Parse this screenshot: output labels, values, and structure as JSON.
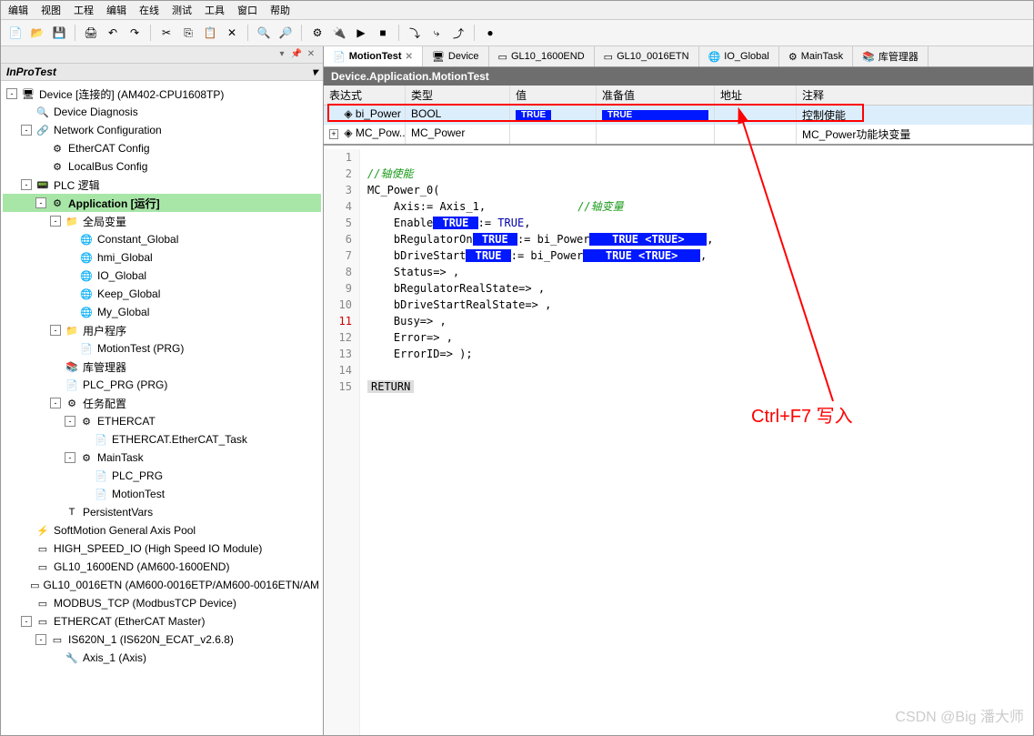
{
  "menu": [
    "编辑",
    "视图",
    "工程",
    "编辑",
    "在线",
    "测试",
    "工具",
    "窗口",
    "帮助"
  ],
  "sidebar": {
    "title": "InProTest",
    "rows": [
      {
        "ind": 0,
        "exp": "-",
        "icon": "device",
        "label": "Device [连接的] (AM402-CPU1608TP)",
        "cls": "link"
      },
      {
        "ind": 1,
        "exp": "",
        "icon": "diag",
        "label": "Device Diagnosis"
      },
      {
        "ind": 1,
        "exp": "-",
        "icon": "net",
        "label": "Network Configuration"
      },
      {
        "ind": 2,
        "exp": "",
        "icon": "cfg",
        "label": "EtherCAT Config"
      },
      {
        "ind": 2,
        "exp": "",
        "icon": "cfg",
        "label": "LocalBus Config"
      },
      {
        "ind": 1,
        "exp": "-",
        "icon": "plc",
        "label": "PLC 逻辑"
      },
      {
        "ind": 2,
        "exp": "-",
        "icon": "app",
        "label": "Application [运行]",
        "running": true
      },
      {
        "ind": 3,
        "exp": "-",
        "icon": "fld",
        "label": "全局变量"
      },
      {
        "ind": 4,
        "exp": "",
        "icon": "glob",
        "label": "Constant_Global"
      },
      {
        "ind": 4,
        "exp": "",
        "icon": "glob",
        "label": "hmi_Global"
      },
      {
        "ind": 4,
        "exp": "",
        "icon": "glob",
        "label": "IO_Global"
      },
      {
        "ind": 4,
        "exp": "",
        "icon": "glob",
        "label": "Keep_Global"
      },
      {
        "ind": 4,
        "exp": "",
        "icon": "glob",
        "label": "My_Global"
      },
      {
        "ind": 3,
        "exp": "-",
        "icon": "fld",
        "label": "用户程序"
      },
      {
        "ind": 4,
        "exp": "",
        "icon": "prg",
        "label": "MotionTest (PRG)"
      },
      {
        "ind": 3,
        "exp": "",
        "icon": "lib",
        "label": "库管理器"
      },
      {
        "ind": 3,
        "exp": "",
        "icon": "prg",
        "label": "PLC_PRG (PRG)"
      },
      {
        "ind": 3,
        "exp": "-",
        "icon": "task",
        "label": "任务配置"
      },
      {
        "ind": 4,
        "exp": "-",
        "icon": "tsk",
        "label": "ETHERCAT"
      },
      {
        "ind": 5,
        "exp": "",
        "icon": "prg",
        "label": "ETHERCAT.EtherCAT_Task"
      },
      {
        "ind": 4,
        "exp": "-",
        "icon": "tsk",
        "label": "MainTask"
      },
      {
        "ind": 5,
        "exp": "",
        "icon": "prg",
        "label": "PLC_PRG"
      },
      {
        "ind": 5,
        "exp": "",
        "icon": "prg",
        "label": "MotionTest"
      },
      {
        "ind": 3,
        "exp": "",
        "icon": "vars",
        "label": "PersistentVars"
      },
      {
        "ind": 1,
        "exp": "",
        "icon": "axis",
        "label": "SoftMotion General Axis Pool"
      },
      {
        "ind": 1,
        "exp": "",
        "icon": "mod",
        "label": "HIGH_SPEED_IO (High Speed IO Module)"
      },
      {
        "ind": 1,
        "exp": "",
        "icon": "mod",
        "label": "GL10_1600END (AM600-1600END)"
      },
      {
        "ind": 1,
        "exp": "",
        "icon": "mod",
        "label": "GL10_0016ETN (AM600-0016ETP/AM600-0016ETN/AM"
      },
      {
        "ind": 1,
        "exp": "",
        "icon": "mod",
        "label": "MODBUS_TCP (ModbusTCP Device)"
      },
      {
        "ind": 1,
        "exp": "-",
        "icon": "mod",
        "label": "ETHERCAT (EtherCAT Master)"
      },
      {
        "ind": 2,
        "exp": "-",
        "icon": "mod",
        "label": "IS620N_1 (IS620N_ECAT_v2.6.8)"
      },
      {
        "ind": 3,
        "exp": "",
        "icon": "axs",
        "label": "Axis_1 (Axis)"
      }
    ]
  },
  "tabs": [
    {
      "icon": "prg",
      "label": "MotionTest",
      "active": true,
      "closable": true
    },
    {
      "icon": "dev",
      "label": "Device"
    },
    {
      "icon": "mod",
      "label": "GL10_1600END"
    },
    {
      "icon": "mod",
      "label": "GL10_0016ETN"
    },
    {
      "icon": "glob",
      "label": "IO_Global"
    },
    {
      "icon": "tsk",
      "label": "MainTask"
    },
    {
      "icon": "lib",
      "label": "库管理器"
    }
  ],
  "breadcrumb": "Device.Application.MotionTest",
  "watch": {
    "headers": [
      "表达式",
      "类型",
      "值",
      "准备值",
      "地址",
      "注释"
    ],
    "rows": [
      {
        "exp": "",
        "icon": "◈",
        "name": "bi_Power",
        "type": "BOOL",
        "val_true": true,
        "prep_true": true,
        "addr": "",
        "cmt": "控制使能",
        "sel": true
      },
      {
        "exp": "+",
        "icon": "◈",
        "name": "MC_Pow...",
        "type": "MC_Power",
        "val": "",
        "prep": "",
        "addr": "",
        "cmt": "MC_Power功能块变量"
      }
    ]
  },
  "code": [
    {
      "n": 1,
      "raw": ""
    },
    {
      "n": 2,
      "cmt": "//轴使能"
    },
    {
      "n": 3,
      "txt": "MC_Power_0("
    },
    {
      "n": 4,
      "txt": "    Axis:= Axis_1,",
      "tail_cmt": "              //轴变量"
    },
    {
      "n": 5,
      "parts": [
        {
          "t": "    Enable"
        },
        {
          "true": " TRUE "
        },
        {
          "t": ":= "
        },
        {
          "kw": "TRUE"
        },
        {
          "t": ","
        }
      ]
    },
    {
      "n": 6,
      "parts": [
        {
          "t": "    bRegulatorOn"
        },
        {
          "true": " TRUE "
        },
        {
          "t": ":= bi_Power"
        },
        {
          "trueex": "   TRUE <TRUE>   "
        },
        {
          "t": ","
        }
      ]
    },
    {
      "n": 7,
      "parts": [
        {
          "t": "    bDriveStart"
        },
        {
          "true": " TRUE "
        },
        {
          "t": ":= bi_Power"
        },
        {
          "trueex": "   TRUE <TRUE>   "
        },
        {
          "t": ","
        }
      ]
    },
    {
      "n": 8,
      "txt": "    Status=> ,"
    },
    {
      "n": 9,
      "txt": "    bRegulatorRealState=> ,"
    },
    {
      "n": 10,
      "txt": "    bDriveStartRealState=> ,"
    },
    {
      "n": 11,
      "txt": "    Busy=> ,"
    },
    {
      "n": 12,
      "txt": "    Error=> ,"
    },
    {
      "n": 13,
      "txt": "    ErrorID=> );"
    },
    {
      "n": 14,
      "raw": ""
    },
    {
      "n": 15,
      "ret": "RETURN"
    }
  ],
  "annotation": "Ctrl+F7 写入",
  "watermark": "CSDN @Big 潘大师"
}
